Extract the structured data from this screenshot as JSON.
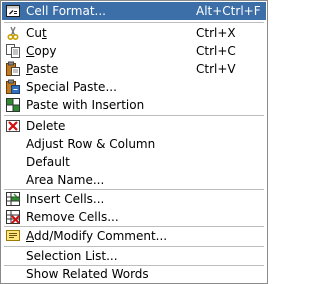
{
  "menu": {
    "items": [
      {
        "label_pre": "Cell Format...",
        "mnemonic": "",
        "label_post": "",
        "shortcut": "Alt+Ctrl+F",
        "icon": "cell-format-icon",
        "selected": true
      },
      {
        "label_pre": "Cu",
        "mnemonic": "t",
        "label_post": "",
        "shortcut": "Ctrl+X",
        "icon": "scissors-icon"
      },
      {
        "label_pre": "",
        "mnemonic": "C",
        "label_post": "opy",
        "shortcut": "Ctrl+C",
        "icon": "copy-icon"
      },
      {
        "label_pre": "",
        "mnemonic": "P",
        "label_post": "aste",
        "shortcut": "Ctrl+V",
        "icon": "paste-icon"
      },
      {
        "label_pre": "Special Paste...",
        "mnemonic": "",
        "label_post": "",
        "shortcut": "",
        "icon": "special-paste-icon"
      },
      {
        "label_pre": "Paste with Insertion",
        "mnemonic": "",
        "label_post": "",
        "shortcut": "",
        "icon": "paste-insert-icon"
      },
      {
        "label_pre": "Delete",
        "mnemonic": "",
        "label_post": "",
        "shortcut": "",
        "icon": "delete-icon"
      },
      {
        "label_pre": "Adjust Row & Column",
        "mnemonic": "",
        "label_post": "",
        "shortcut": "",
        "icon": ""
      },
      {
        "label_pre": "Default",
        "mnemonic": "",
        "label_post": "",
        "shortcut": "",
        "icon": ""
      },
      {
        "label_pre": "Area Name...",
        "mnemonic": "",
        "label_post": "",
        "shortcut": "",
        "icon": ""
      },
      {
        "label_pre": "Insert Cells...",
        "mnemonic": "",
        "label_post": "",
        "shortcut": "",
        "icon": "insert-cells-icon"
      },
      {
        "label_pre": "Remove Cells...",
        "mnemonic": "",
        "label_post": "",
        "shortcut": "",
        "icon": "remove-cells-icon"
      },
      {
        "label_pre": "",
        "mnemonic": "A",
        "label_post": "dd/Modify Comment...",
        "shortcut": "",
        "icon": "comment-icon"
      },
      {
        "label_pre": "Selection List...",
        "mnemonic": "",
        "label_post": "",
        "shortcut": "",
        "icon": ""
      },
      {
        "label_pre": "Show Related Words",
        "mnemonic": "",
        "label_post": "",
        "shortcut": "",
        "icon": ""
      }
    ]
  },
  "colors": {
    "selection": "#3c6ea8",
    "separator": "#bdbdbd",
    "border": "#8a8a8a"
  }
}
